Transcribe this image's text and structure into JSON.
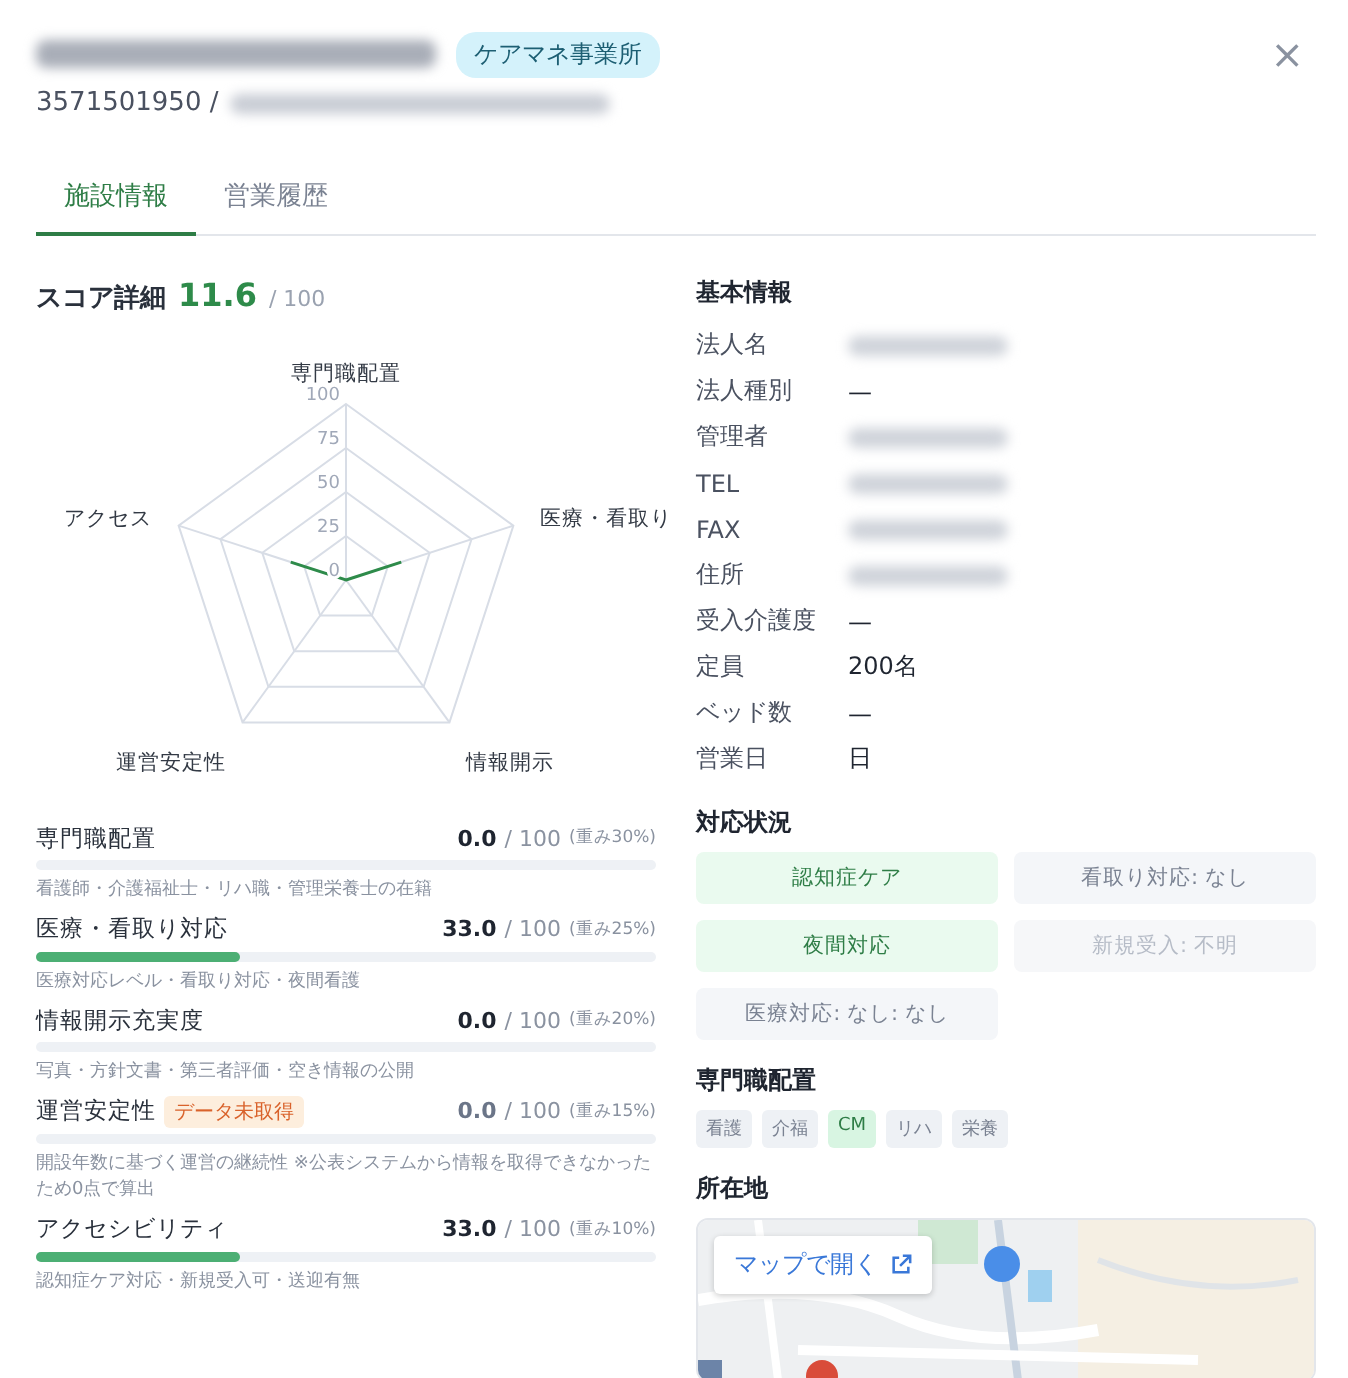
{
  "header": {
    "id_prefix": "3571501950 /",
    "badge": "ケアマネ事業所",
    "close": "×"
  },
  "tabs": [
    {
      "label": "施設情報",
      "selected": true
    },
    {
      "label": "営業履歴",
      "selected": false
    }
  ],
  "score": {
    "title": "スコア詳細",
    "value": "11.6",
    "max": "/ 100",
    "chart_data": {
      "type": "radar",
      "categories": [
        "専門職配置",
        "医療・看取り",
        "情報開示",
        "運営安定性",
        "アクセス"
      ],
      "series": [
        {
          "color": "#2e8b4a",
          "values": [
            0,
            33,
            0,
            0,
            33
          ]
        }
      ],
      "ylim": [
        0,
        100
      ],
      "yticks": [
        0,
        25,
        50,
        75,
        100
      ]
    },
    "items": [
      {
        "name": "専門職配置",
        "score": "0.0",
        "max": "/ 100",
        "weight": "(重み30%)",
        "note": "看護師・介護福祉士・リハ職・管理栄養士の在籍"
      },
      {
        "name": "医療・看取り対応",
        "score": "33.0",
        "max": "/ 100",
        "weight": "(重み25%)",
        "level": 0.33,
        "note": "医療対応レベル・看取り対応・夜間看護"
      },
      {
        "name": "情報開示充実度",
        "score": "0.0",
        "max": "/ 100",
        "weight": "(重み20%)",
        "note": "写真・方針文書・第三者評価・空き情報の公開"
      },
      {
        "name": "運営安定性",
        "tag": "データ未取得",
        "score": "0.0",
        "max": "/ 100",
        "weight": "(重み15%)",
        "muted": true,
        "note": "開設年数に基づく運営の継続性 ※公表システムから情報を取得できなかったため0点で算出"
      },
      {
        "name": "アクセシビリティ",
        "score": "33.0",
        "max": "/ 100",
        "weight": "(重み10%)",
        "level": 0.33,
        "note": "認知症ケア対応・新規受入可・送迎有無"
      }
    ]
  },
  "basic_info": {
    "title": "基本情報",
    "rows": [
      {
        "label": "法人名",
        "blurred": true
      },
      {
        "label": "法人種別",
        "value": "—"
      },
      {
        "label": "管理者",
        "blurred": true
      },
      {
        "label": "TEL",
        "blurred": true
      },
      {
        "label": "FAX",
        "blurred": true
      },
      {
        "label": "住所",
        "blurred": true
      },
      {
        "label": "受入介護度",
        "value": "—"
      },
      {
        "label": "定員",
        "value": "200名"
      },
      {
        "label": "ベッド数",
        "value": "—"
      },
      {
        "label": "営業日",
        "value": "日"
      }
    ]
  },
  "support": {
    "title": "対応状況",
    "chips": [
      {
        "label": "認知症ケア",
        "kind": "yes"
      },
      {
        "label": "看取り対応: なし",
        "kind": "no"
      },
      {
        "label": "夜間対応",
        "kind": "yes"
      },
      {
        "label": "新規受入: 不明",
        "kind": "unknown"
      },
      {
        "label": "医療対応: なし: なし",
        "kind": "no"
      }
    ]
  },
  "staff": {
    "title": "専門職配置",
    "tags": [
      {
        "label": "看護",
        "on": false
      },
      {
        "label": "介福",
        "on": false
      },
      {
        "label": "CM",
        "on": true
      },
      {
        "label": "リハ",
        "on": false
      },
      {
        "label": "栄養",
        "on": false
      }
    ]
  },
  "location": {
    "title": "所在地",
    "open_button": "マップで開く"
  }
}
